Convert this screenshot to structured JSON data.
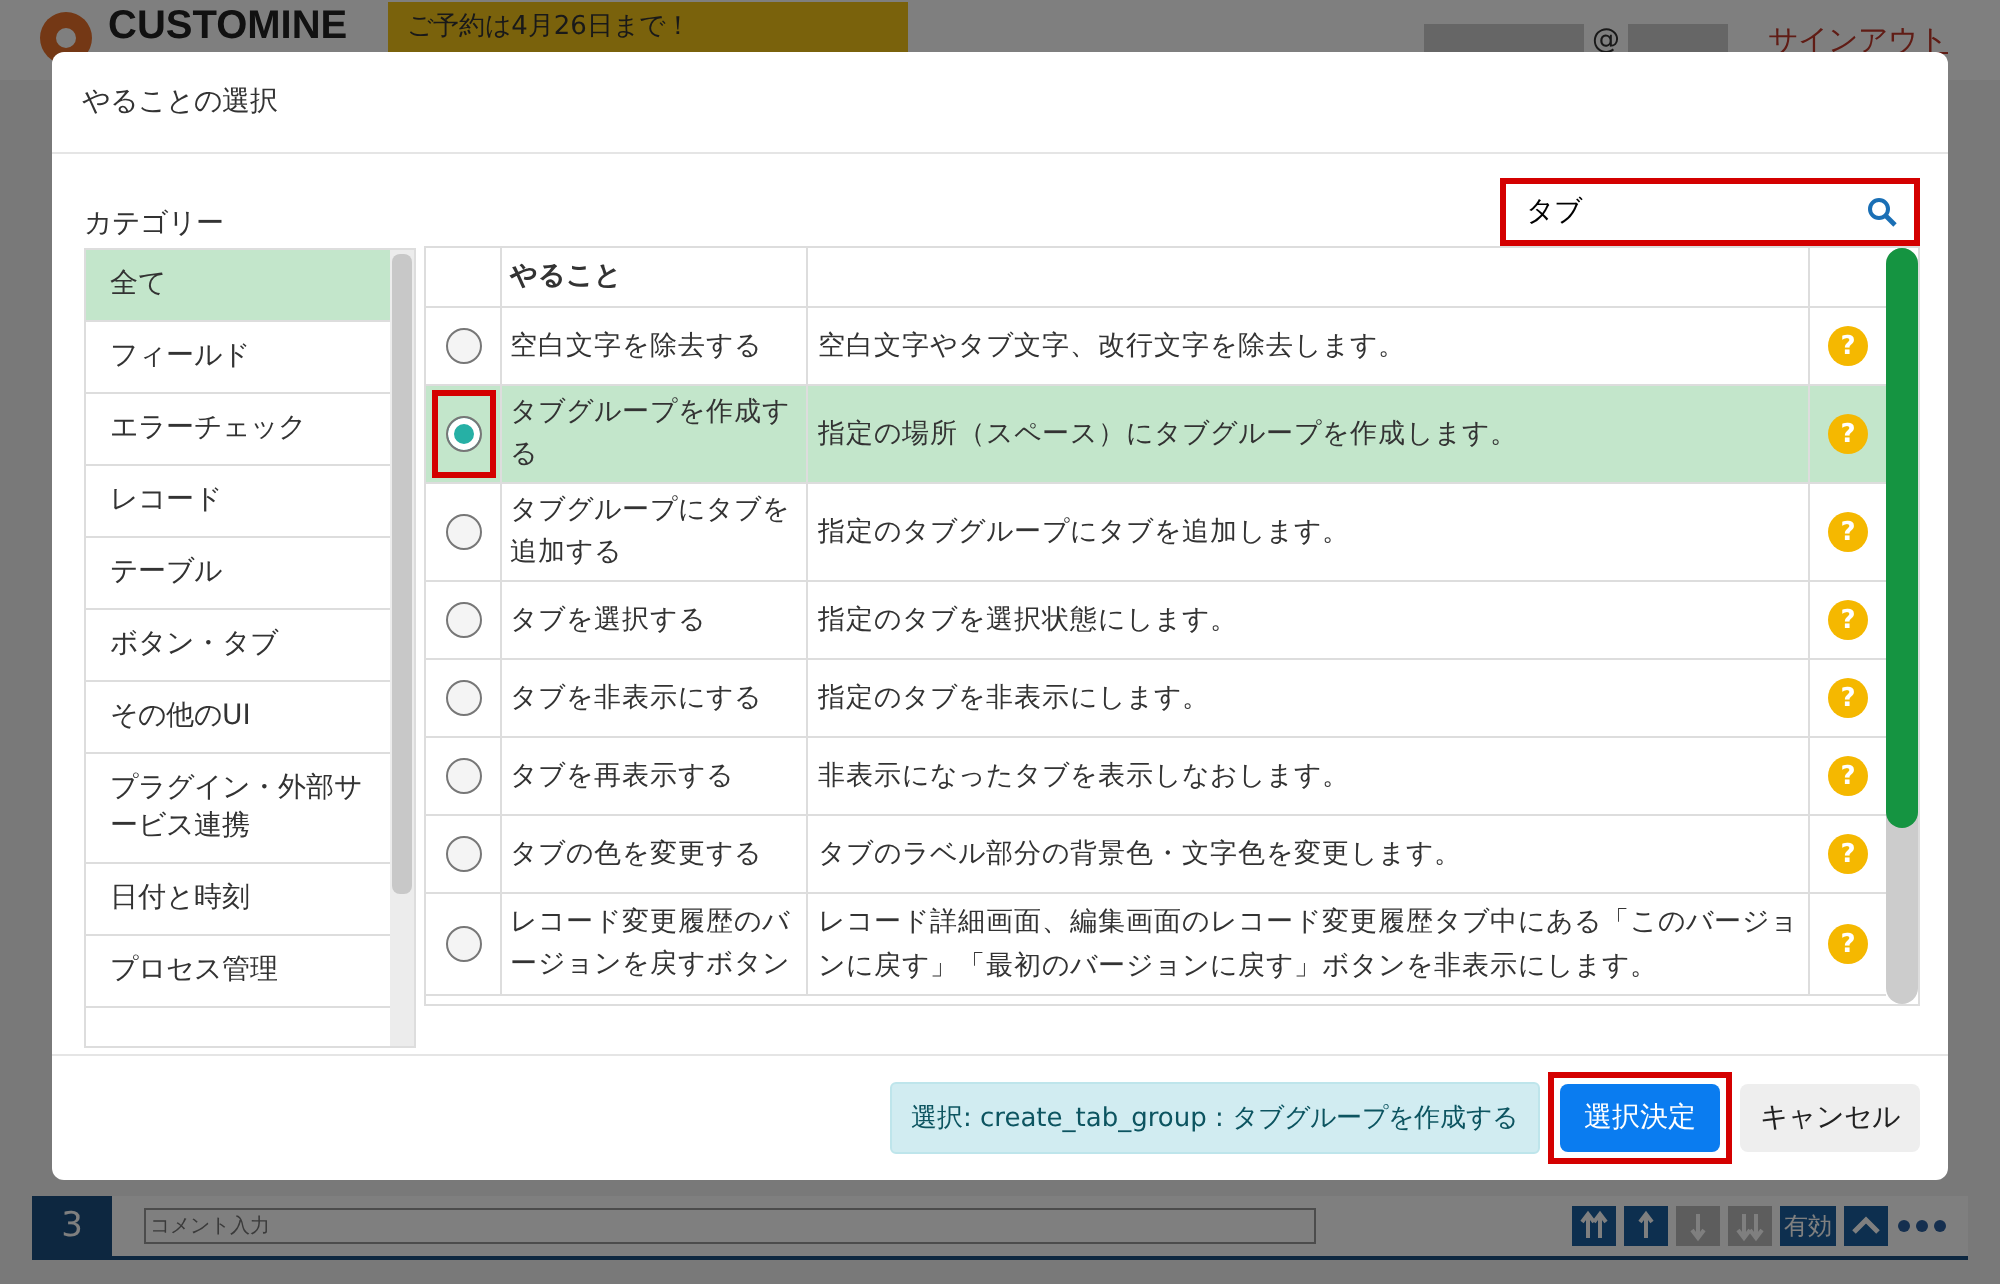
{
  "background_page": {
    "logo": "CUSTOMINE",
    "banner": "ご予約は4月26日まで！",
    "user_at": "@",
    "signout": "サインアウト",
    "bottom_bar": {
      "number": "3",
      "comment_placeholder": "コメント入力",
      "enabled_label": "有効"
    }
  },
  "dialog": {
    "title": "やることの選択",
    "category_label": "カテゴリー",
    "categories": [
      {
        "label": "全て",
        "selected": true
      },
      {
        "label": "フィールド",
        "selected": false
      },
      {
        "label": "エラーチェック",
        "selected": false
      },
      {
        "label": "レコード",
        "selected": false
      },
      {
        "label": "テーブル",
        "selected": false
      },
      {
        "label": "ボタン・タブ",
        "selected": false
      },
      {
        "label": "その他のUI",
        "selected": false
      },
      {
        "label": "プラグイン・外部サービス連携",
        "selected": false
      },
      {
        "label": "日付と時刻",
        "selected": false
      },
      {
        "label": "プロセス管理",
        "selected": false
      }
    ],
    "search": {
      "value": "タブ",
      "highlighted": true
    },
    "table": {
      "columns": [
        "やること"
      ],
      "rows": [
        {
          "action": "空白文字を除去する",
          "description": "空白文字やタブ文字、改行文字を除去します。",
          "help": "?",
          "selected": false,
          "highlighted": false
        },
        {
          "action": "タブグループを作成する",
          "description": "指定の場所（スペース）にタブグループを作成します。",
          "help": "?",
          "selected": true,
          "highlighted": true
        },
        {
          "action": "タブグループにタブを追加する",
          "description": "指定のタブグループにタブを追加します。",
          "help": "?",
          "selected": false,
          "highlighted": false
        },
        {
          "action": "タブを選択する",
          "description": "指定のタブを選択状態にします。",
          "help": "?",
          "selected": false,
          "highlighted": false
        },
        {
          "action": "タブを非表示にする",
          "description": "指定のタブを非表示にします。",
          "help": "?",
          "selected": false,
          "highlighted": false
        },
        {
          "action": "タブを再表示する",
          "description": "非表示になったタブを表示しなおします。",
          "help": "?",
          "selected": false,
          "highlighted": false
        },
        {
          "action": "タブの色を変更する",
          "description": "タブのラベル部分の背景色・文字色を変更します。",
          "help": "?",
          "selected": false,
          "highlighted": false
        },
        {
          "action": "レコード変更履歴のバージョンを戻すボタン",
          "description": "レコード詳細画面、編集画面のレコード変更履歴タブ中にある「このバージョンに戻す」「最初のバージョンに戻す」ボタンを非表示にします。",
          "help": "?",
          "selected": false,
          "highlighted": false
        }
      ]
    },
    "selection_status": "選択: create_tab_group : タブグループを作成する",
    "confirm_button": {
      "label": "選択決定",
      "highlighted": true
    },
    "cancel_button": "キャンセル"
  }
}
